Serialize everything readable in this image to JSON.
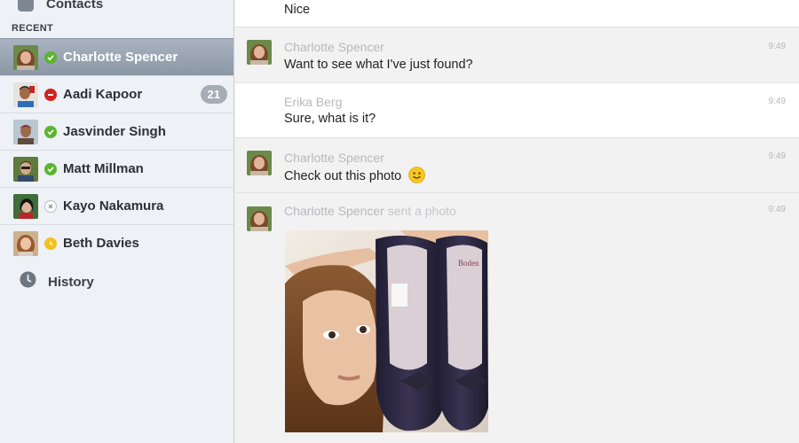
{
  "sidebar": {
    "contacts_label": "Contacts",
    "section_label": "RECENT",
    "items": [
      {
        "name": "Charlotte Spencer",
        "status": "online",
        "active": true
      },
      {
        "name": "Aadi Kapoor",
        "status": "busy",
        "badge": "21"
      },
      {
        "name": "Jasvinder Singh",
        "status": "online"
      },
      {
        "name": "Matt Millman",
        "status": "online"
      },
      {
        "name": "Kayo Nakamura",
        "status": "offline"
      },
      {
        "name": "Beth Davies",
        "status": "away"
      }
    ],
    "history_label": "History"
  },
  "chat": {
    "messages": [
      {
        "text": "Nice"
      },
      {
        "sender": "Charlotte Spencer",
        "time": "9:49",
        "text": "Want to see what I've just found?"
      },
      {
        "sender": "Erika Berg",
        "time": "9:49",
        "text": "Sure, what is it?"
      },
      {
        "sender": "Charlotte Spencer",
        "time": "9:49",
        "text": "Check out this photo",
        "emoji": "smiley-emoji"
      },
      {
        "sender": "Charlotte Spencer",
        "sender_suffix": "sent a photo",
        "time": "9:49",
        "attachment": "photo-of-shoes"
      }
    ]
  },
  "colors": {
    "online": "#5bb52f",
    "busy": "#d4221f",
    "away": "#f2c21c",
    "active_row": "#9aa4b1",
    "sender_text": "#b6b8bb"
  }
}
